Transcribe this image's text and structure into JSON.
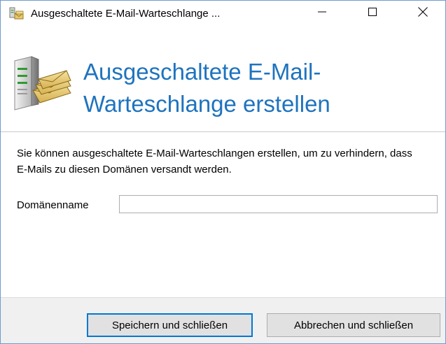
{
  "window": {
    "title": "Ausgeschaltete E-Mail-Warteschlange ...",
    "icon": "mail-queue-icon",
    "controls": {
      "minimize": "minimize-icon",
      "maximize": "maximize-icon",
      "close": "close-icon"
    }
  },
  "header": {
    "title": "Ausgeschaltete E-Mail-Warteschlange erstellen",
    "icon": "server-mail-icon",
    "title_color": "#1e73be"
  },
  "content": {
    "description": "Sie können ausgeschaltete E-Mail-Warteschlangen erstellen, um zu verhindern, dass E-Mails zu diesen Domänen versandt werden.",
    "domain_label": "Domänenname",
    "domain_value": ""
  },
  "footer": {
    "save_label": "Speichern und schließen",
    "cancel_label": "Abbrechen und schließen"
  },
  "colors": {
    "accent": "#0078d7",
    "window_border": "#6e9ccf",
    "footer_background": "#f0f0f0"
  }
}
